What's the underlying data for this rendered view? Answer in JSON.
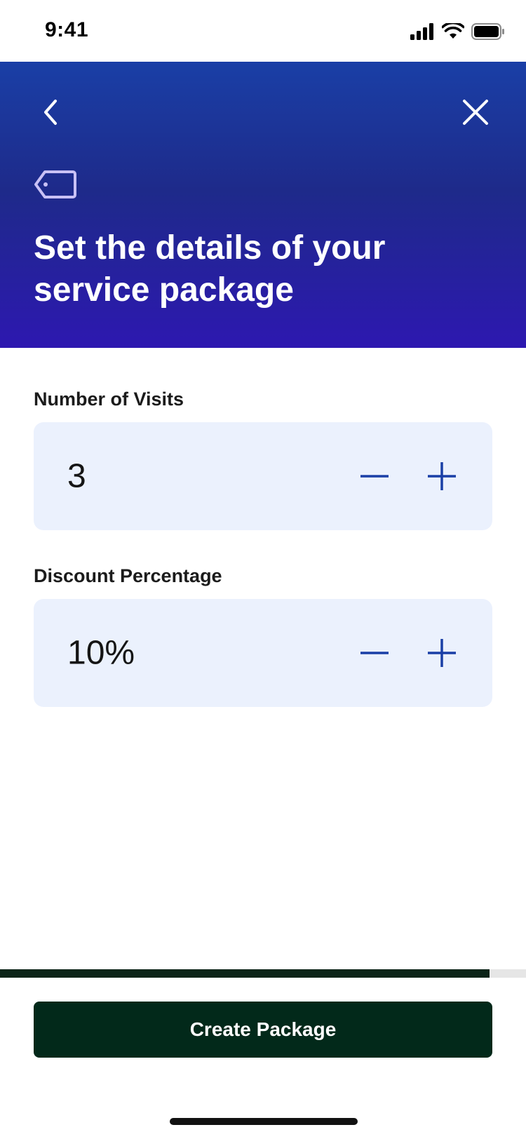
{
  "status_bar": {
    "time": "9:41"
  },
  "header": {
    "title": "Set the details of your service package"
  },
  "fields": {
    "visits": {
      "label": "Number of Visits",
      "value": "3"
    },
    "discount": {
      "label": "Discount Percentage",
      "value": "10%"
    }
  },
  "progress": {
    "fraction": 0.93
  },
  "actions": {
    "create_label": "Create Package"
  },
  "colors": {
    "header_top": "#1a3fa6",
    "header_bottom": "#2d18b0",
    "stepper_bg": "#ebf1fd",
    "stepper_icon": "#1a3fa6",
    "tag_icon": "#c9c1f5",
    "cta_bg": "#02291a"
  },
  "icons": [
    "back-icon",
    "close-icon",
    "tag-icon",
    "minus-icon",
    "plus-icon",
    "signal-icon",
    "wifi-icon",
    "battery-icon"
  ]
}
